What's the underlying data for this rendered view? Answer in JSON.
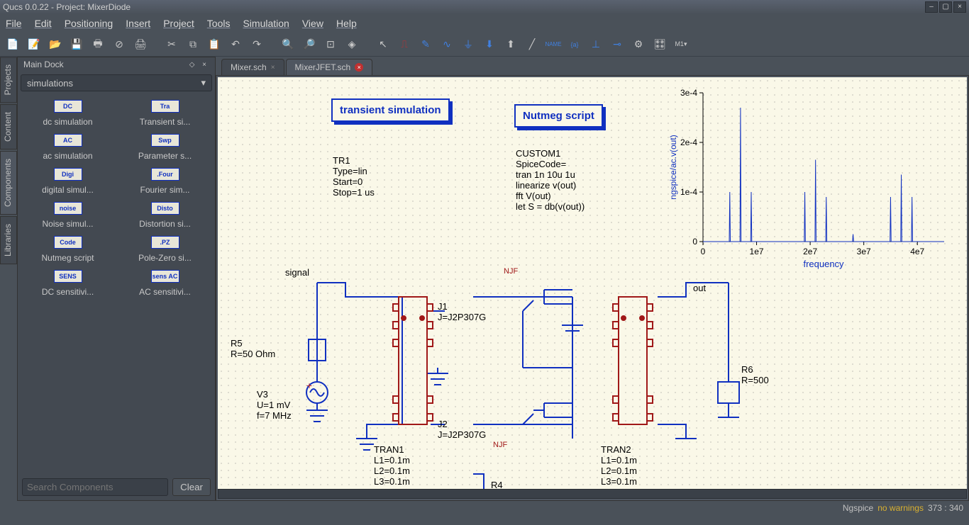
{
  "title": "Qucs 0.0.22 - Project: MixerDiode",
  "menu": [
    "File",
    "Edit",
    "Positioning",
    "Insert",
    "Project",
    "Tools",
    "Simulation",
    "View",
    "Help"
  ],
  "dock": {
    "title": "Main Dock",
    "combo": "simulations",
    "side_tabs": [
      "Projects",
      "Content",
      "Components",
      "Libraries"
    ],
    "items": [
      {
        "icon": "DC",
        "label": "dc simulation"
      },
      {
        "icon": "Tra",
        "label": "Transient si..."
      },
      {
        "icon": "AC",
        "label": "ac simulation"
      },
      {
        "icon": "Swp",
        "label": "Parameter s..."
      },
      {
        "icon": "Digi",
        "label": "digital simul..."
      },
      {
        "icon": ".Four",
        "label": "Fourier sim..."
      },
      {
        "icon": "noise",
        "label": "Noise simul..."
      },
      {
        "icon": "Disto",
        "label": "Distortion si..."
      },
      {
        "icon": "Code",
        "label": "Nutmeg script"
      },
      {
        "icon": ".PZ",
        "label": "Pole-Zero si..."
      },
      {
        "icon": "SENS",
        "label": "DC sensitivi..."
      },
      {
        "icon": "sens AC",
        "label": "AC sensitivi..."
      }
    ],
    "search_ph": "Search Components",
    "clear": "Clear"
  },
  "tabs": [
    {
      "name": "Mixer.sch",
      "active": false
    },
    {
      "name": "MixerJFET.sch",
      "active": true,
      "dirty": true
    }
  ],
  "sim_tran": {
    "title": "transient\nsimulation",
    "body": "TR1\nType=lin\nStart=0\nStop=1 us"
  },
  "sim_nut": {
    "title": "Nutmeg script",
    "body": "CUSTOM1\nSpiceCode=\ntran 1n 10u 1u\nlinearize v(out)\nfft V(out)\nlet S = db(v(out))"
  },
  "labels": {
    "signal": "signal",
    "out": "out",
    "njf1": "NJF",
    "njf2": "NJF",
    "v3": "V3\nU=1 mV\nf=7 MHz",
    "r5": "R5\nR=50 Ohm",
    "r6": "R6\nR=500",
    "j1": "J1\nJ=J2P307G",
    "j2": "J2\nJ=J2P307G",
    "r4": "R4",
    "tran1": "TRAN1\nL1=0.1m\nL2=0.1m\nL3=0.1m",
    "tran2": "TRAN2\nL1=0.1m\nL2=0.1m\nL3=0.1m"
  },
  "chart_data": {
    "type": "line",
    "title": "",
    "xlabel": "frequency",
    "ylabel": "ngspice/ac.v(out)",
    "xlim": [
      0,
      45000000.0
    ],
    "ylim": [
      0,
      0.0003
    ],
    "xticks": [
      0,
      10000000.0,
      20000000.0,
      30000000.0,
      40000000.0
    ],
    "xtick_labels": [
      "0",
      "1e7",
      "2e7",
      "3e7",
      "4e7"
    ],
    "yticks": [
      0,
      0.0001,
      0.0002,
      0.0003
    ],
    "ytick_labels": [
      "0",
      "1e-4",
      "2e-4",
      "3e-4"
    ],
    "peaks_x": [
      5000000.0,
      7000000.0,
      9000000.0,
      19000000.0,
      21000000.0,
      23000000.0,
      28000000.0,
      35000000.0,
      37000000.0,
      39000000.0
    ],
    "peaks_y": [
      0.0001,
      0.00027,
      0.0001,
      0.0001,
      0.000165,
      9e-05,
      1.5e-05,
      9e-05,
      0.000135,
      9e-05
    ]
  },
  "status": {
    "engine": "Ngspice",
    "warn": "no warnings",
    "coords": "373 : 340"
  }
}
